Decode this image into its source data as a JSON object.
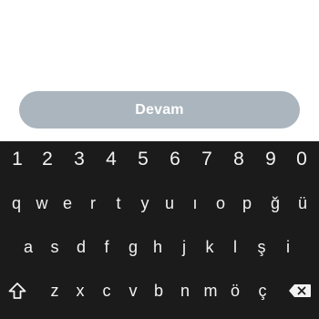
{
  "button": {
    "continue_label": "Devam"
  },
  "keyboard": {
    "numbers": [
      "1",
      "2",
      "3",
      "4",
      "5",
      "6",
      "7",
      "8",
      "9",
      "0"
    ],
    "row1": [
      "q",
      "w",
      "e",
      "r",
      "t",
      "y",
      "u",
      "ı",
      "o",
      "p",
      "ğ",
      "ü"
    ],
    "row2": [
      "a",
      "s",
      "d",
      "f",
      "g",
      "h",
      "j",
      "k",
      "l",
      "ş",
      "i"
    ],
    "row3": [
      "z",
      "x",
      "c",
      "v",
      "b",
      "n",
      "m",
      "ö",
      "ç"
    ],
    "shift_icon": "shift-icon",
    "backspace_icon": "backspace-icon"
  },
  "colors": {
    "button_bg": "#aab5bd",
    "keyboard_bg": "#1b1b1b",
    "key_text": "#f2f2f2"
  }
}
